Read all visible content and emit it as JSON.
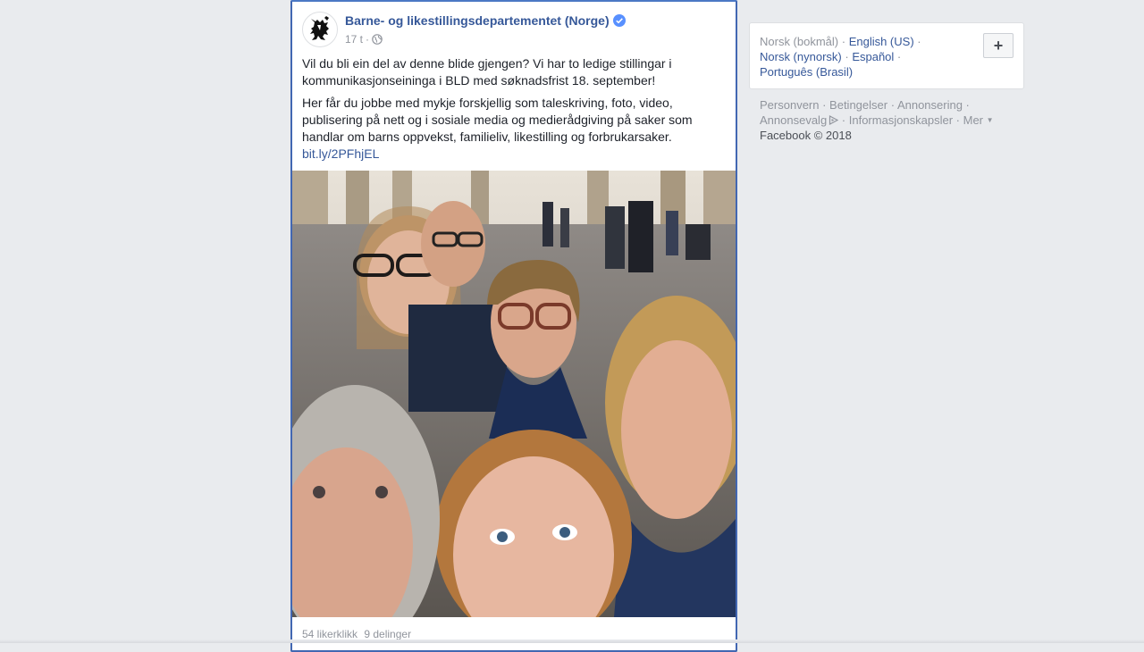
{
  "post": {
    "author": "Barne- og likestillingsdepartementet (Norge)",
    "timestamp": "17 t",
    "separator": "·",
    "paragraph1": "Vil du bli ein del av denne blide gjengen? Vi har to ledige stillingar i kommunikasjonseininga i BLD med søknadsfrist 18. september!",
    "paragraph2": "Her får du jobbe med mykje forskjellig som taleskriving, foto, video, publisering på nett og i sosiale media og medierådgiving på saker som handlar om barns oppvekst, familieliv, likestilling og forbrukarsaker.",
    "link": "bit.ly/2PFhjEL",
    "likes": "54 likerklikk",
    "shares": "9 delinger"
  },
  "languages": {
    "current": "Norsk (bokmål)",
    "english": "English (US)",
    "nynorsk": "Norsk (nynorsk)",
    "espanol": "Español",
    "portugues": "Português (Brasil)",
    "add_label": "+"
  },
  "footer": {
    "privacy": "Personvern",
    "terms": "Betingelser",
    "ads": "Annonsering",
    "adchoices": "Annonsevalg",
    "cookies": "Informasjonskapsler",
    "more": "Mer",
    "copyright": "Facebook © 2018"
  },
  "colors": {
    "link": "#365899",
    "border_active": "#4267b2",
    "background": "#e9ebee",
    "verified": "#5890ff"
  },
  "icons": {
    "verified": "verified-badge-icon",
    "audience": "globe-icon",
    "adchoices": "adchoices-icon",
    "more": "caret-down-icon"
  }
}
